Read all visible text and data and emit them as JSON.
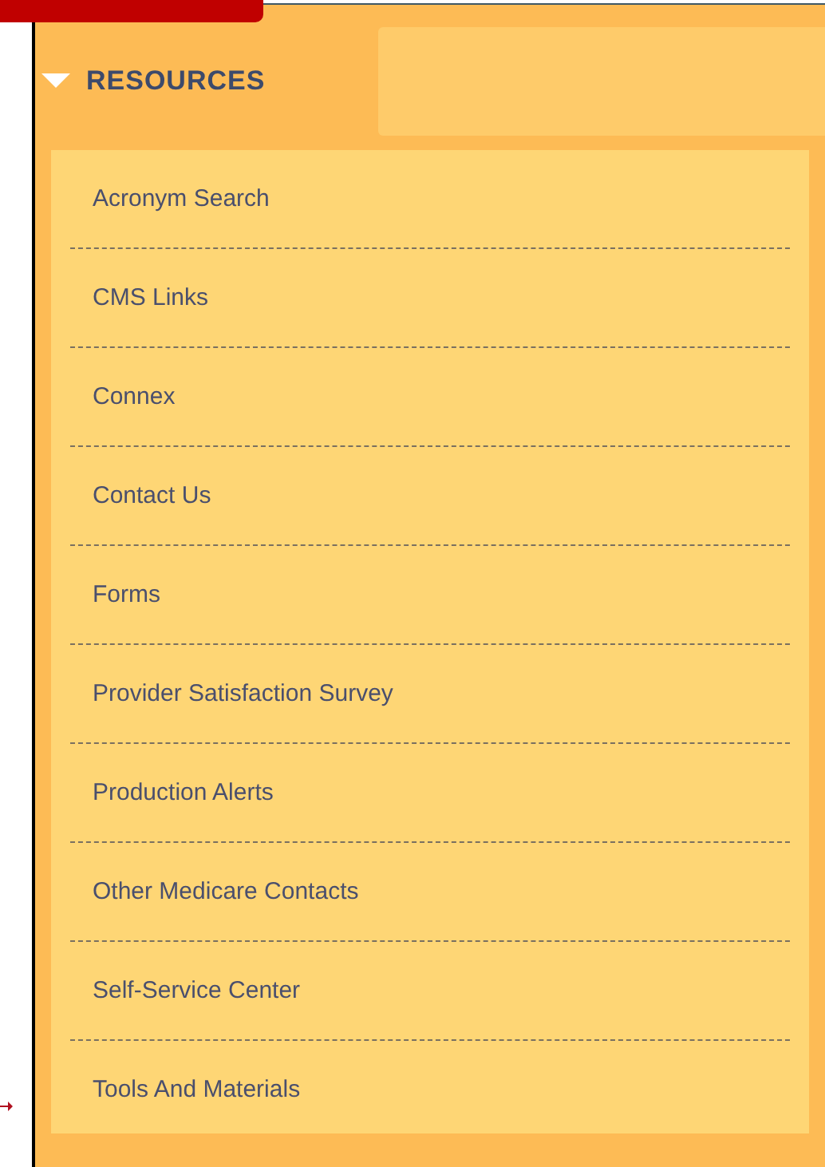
{
  "section": {
    "label": "RESOURCES",
    "expanded": true
  },
  "items": [
    "Acronym Search",
    "CMS Links",
    "Connex",
    "Contact Us",
    "Forms",
    "Provider Satisfaction Survey",
    "Production Alerts",
    "Other Medicare Contacts",
    "Self-Service Center",
    "Tools And Materials"
  ]
}
